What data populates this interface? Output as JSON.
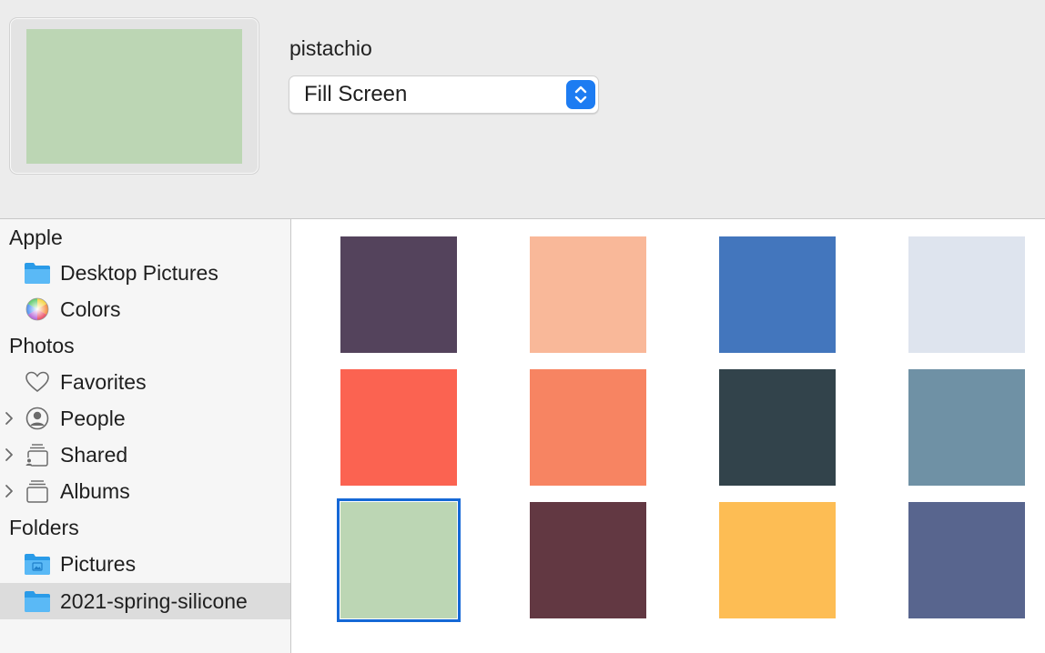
{
  "preview": {
    "name": "pistachio",
    "color": "#bcd6b4"
  },
  "fill_mode": {
    "selected": "Fill Screen",
    "stepper_color": "#1d7cf2"
  },
  "sidebar": {
    "apple_header": "Apple",
    "desktop_pictures": "Desktop Pictures",
    "colors": "Colors",
    "photos_header": "Photos",
    "favorites": "Favorites",
    "people": "People",
    "shared": "Shared",
    "albums": "Albums",
    "folders_header": "Folders",
    "pictures": "Pictures",
    "spring_folder": "2021-spring-silicone"
  },
  "swatches": [
    {
      "color": "#54435c"
    },
    {
      "color": "#f9b899"
    },
    {
      "color": "#4376bd"
    },
    {
      "color": "#dee4ee"
    },
    {
      "color": "#fb6351"
    },
    {
      "color": "#f78462"
    },
    {
      "color": "#32434b"
    },
    {
      "color": "#6f91a5"
    },
    {
      "color": "#bcd6b4",
      "selected": true
    },
    {
      "color": "#623842"
    },
    {
      "color": "#fdbd54"
    },
    {
      "color": "#58658e"
    }
  ],
  "accent_color": "#1568d6"
}
